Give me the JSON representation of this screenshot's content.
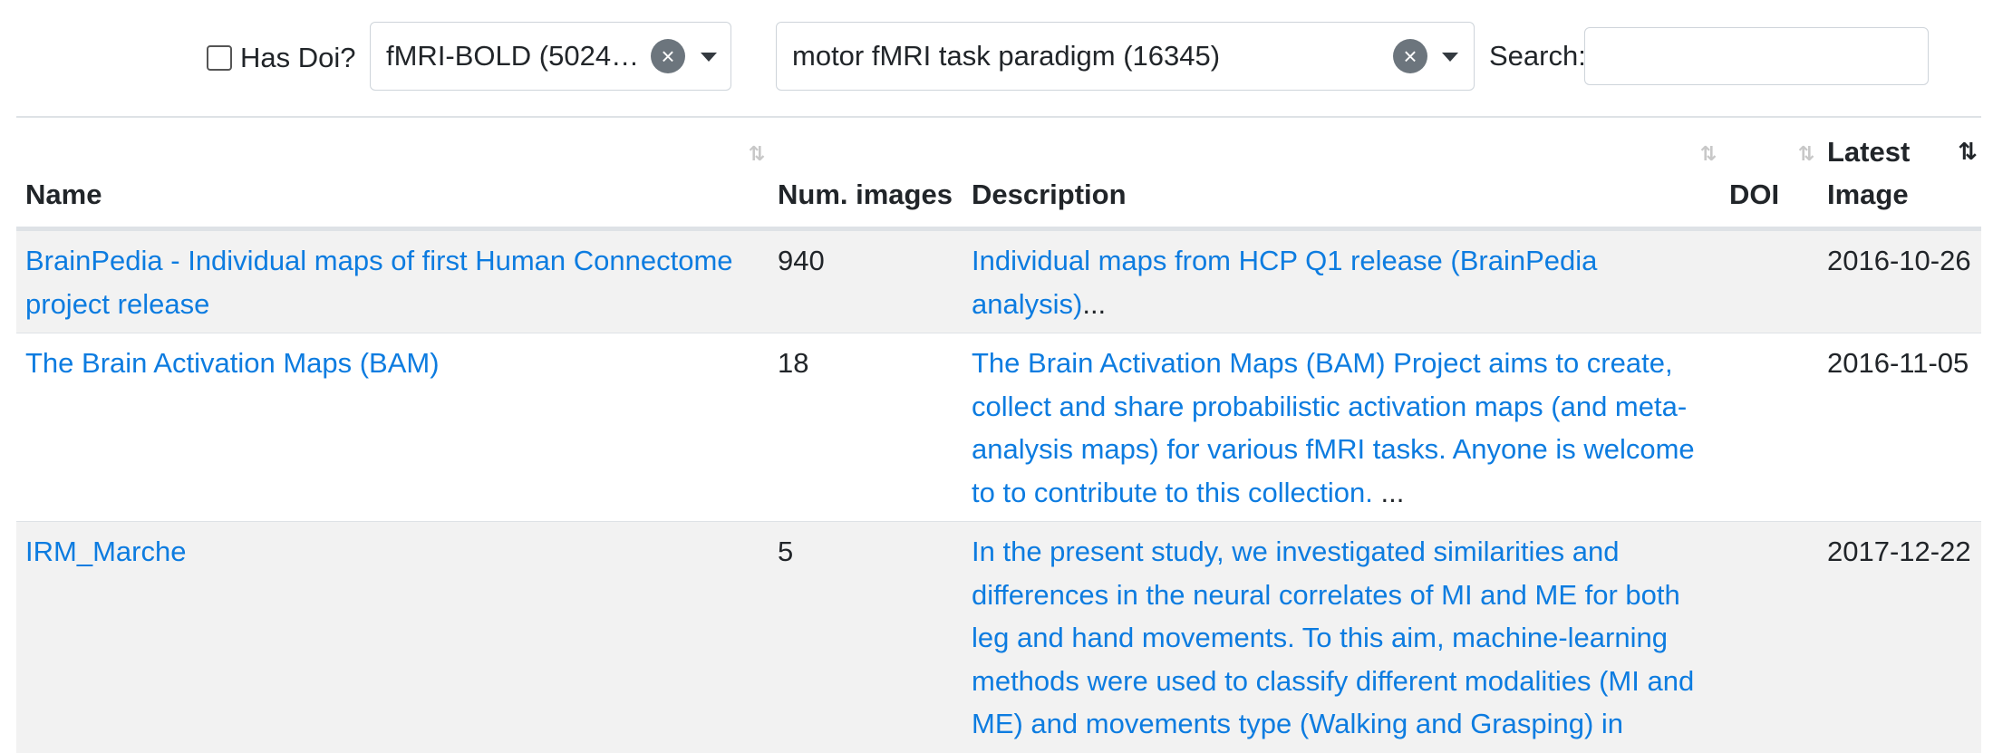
{
  "filters": {
    "has_doi_label": "Has Doi?",
    "modality_select": "fMRI-BOLD (50247…",
    "paradigm_select": "motor fMRI task paradigm (16345)",
    "clear_glyph": "×",
    "search_label": "Search:",
    "search_value": "",
    "search_placeholder": ""
  },
  "table": {
    "columns": [
      {
        "label": "Name",
        "sort": "⇅"
      },
      {
        "label": "Num. images",
        "sort": ""
      },
      {
        "label": "Description",
        "sort": "⇅"
      },
      {
        "label": "DOI",
        "sort": "⇅"
      },
      {
        "label": "Latest Image",
        "sort": "⇅"
      }
    ],
    "rows": [
      {
        "name": "BrainPedia - Individual maps of first Human Connectome project release",
        "num_images": "940",
        "description": "Individual maps from HCP Q1 release (BrainPedia analysis)",
        "description_suffix": "...",
        "doi": "",
        "latest_image": "2016-10-26"
      },
      {
        "name": "The Brain Activation Maps (BAM)",
        "num_images": "18",
        "description": "The Brain Activation Maps (BAM) Project aims to create, collect and share probabilistic activation maps (and meta-analysis maps) for various fMRI tasks. Anyone is welcome to to contribute to this collection.",
        "description_suffix": " ...",
        "doi": "",
        "latest_image": "2016-11-05"
      },
      {
        "name": "IRM_Marche",
        "num_images": "5",
        "description": "In the present study, we investigated similarities and differences in the neural correlates of MI and ME for both leg and hand movements. To this aim, machine-learning methods were used to classify different modalities (MI and ME) and movements type (Walking and Grasping) in",
        "description_suffix": "",
        "doi": "",
        "latest_image": "2017-12-22"
      }
    ]
  },
  "colors": {
    "link": "#0d7ce0",
    "stripe": "#f2f2f2",
    "border": "#dee2e6",
    "clear_button": "#6c757d"
  }
}
